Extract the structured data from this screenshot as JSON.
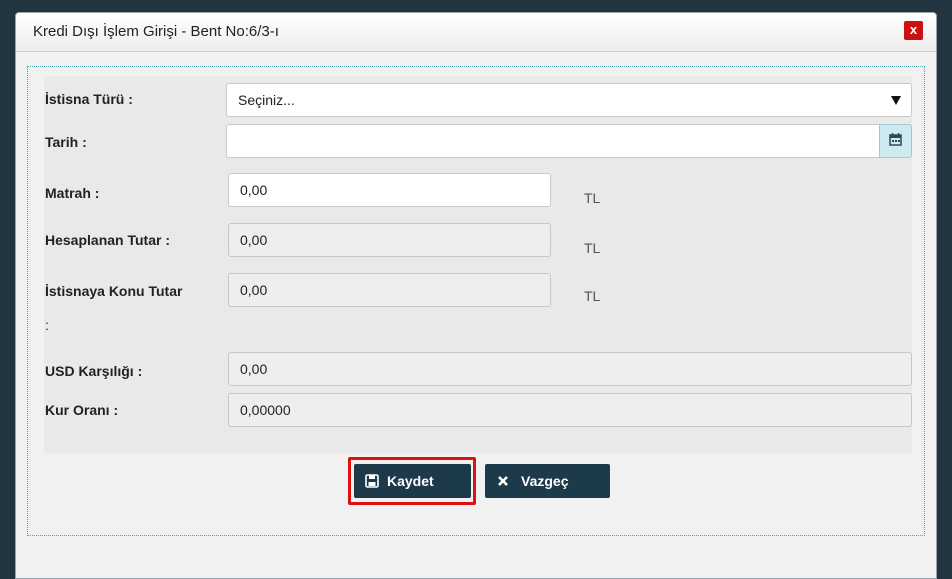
{
  "dialog": {
    "title": "Kredi Dışı İşlem Girişi - Bent No:6/3-ı",
    "close_glyph": "x"
  },
  "form": {
    "istisna_turu": {
      "label": "İstisna Türü :",
      "value": "Seçiniz..."
    },
    "tarih": {
      "label": "Tarih :",
      "value": ""
    },
    "matrah": {
      "label": "Matrah :",
      "value": "0,00",
      "unit": "TL"
    },
    "hesaplanan_tutar": {
      "label": "Hesaplanan Tutar :",
      "value": "0,00",
      "unit": "TL"
    },
    "istisnaya_konu_tutar": {
      "label_line1": "İstisnaya Konu Tutar",
      "label_line2": ":",
      "value": "0,00",
      "unit": "TL"
    },
    "usd_karsiligi": {
      "label": "USD Karşılığı :",
      "value": "0,00"
    },
    "kur_orani": {
      "label": "Kur Oranı :",
      "value": "0,00000"
    }
  },
  "buttons": {
    "save": {
      "label": "Kaydet"
    },
    "cancel": {
      "label": "Vazgeç"
    }
  },
  "icons": [
    "close-icon",
    "chevron-down-icon",
    "calendar-icon",
    "save-icon",
    "x-icon"
  ],
  "colors": {
    "button_bg": "#1d3a4a",
    "close_bg": "#cc1111",
    "focus_outline": "#e01010",
    "frame_dots": "#4aa6b8"
  }
}
